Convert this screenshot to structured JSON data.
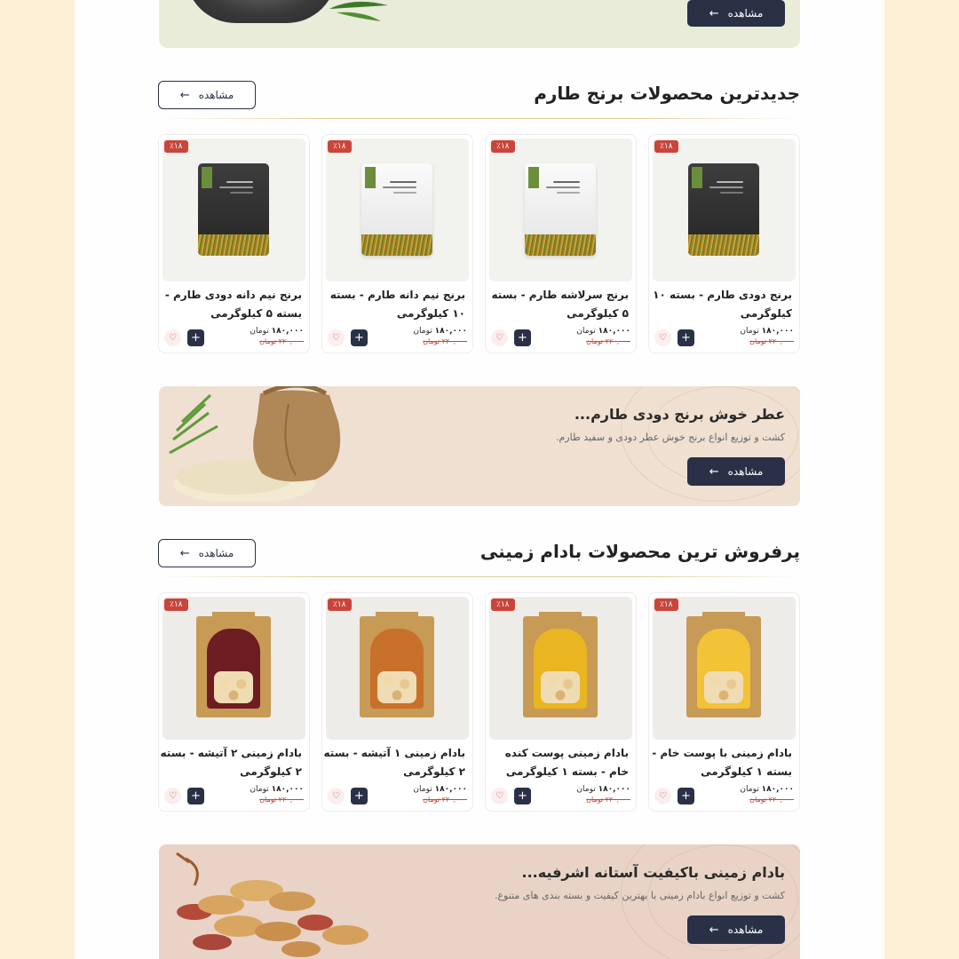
{
  "top_banner": {
    "view_label": "مشاهده"
  },
  "sections": [
    {
      "title": "جدیدترین محصولات برنج طارم",
      "view_label": "مشاهده",
      "products": [
        {
          "name": "برنج  دودی طارم - بسته ۱۰ کیلوگرمی",
          "badge": "٪۱۸",
          "price": "۱۸۰,۰۰۰",
          "currency": "تومان",
          "old_price": "۲۲۰,۰۰۰",
          "old_currency": "تومان",
          "image": "black-rice-bag"
        },
        {
          "name": "برنج سرلاشه طارم - بسته ۵ کیلوگرمی",
          "badge": "٪۱۸",
          "price": "۱۸۰,۰۰۰",
          "currency": "تومان",
          "old_price": "۲۲۰,۰۰۰",
          "old_currency": "تومان",
          "image": "white-rice-bag"
        },
        {
          "name": "برنج نیم دانه طارم - بسته ۱۰ کیلوگرمی",
          "badge": "٪۱۸",
          "price": "۱۸۰,۰۰۰",
          "currency": "تومان",
          "old_price": "۲۲۰,۰۰۰",
          "old_currency": "تومان",
          "image": "white-rice-bag"
        },
        {
          "name": "برنج نیم دانه دودی طارم - بسته ۵ کیلوگرمی",
          "badge": "٪۱۸",
          "price": "۱۸۰,۰۰۰",
          "currency": "تومان",
          "old_price": "۲۲۰,۰۰۰",
          "old_currency": "تومان",
          "image": "black-rice-bag"
        }
      ]
    },
    {
      "title": "پرفروش ترین محصولات بادام زمینی",
      "view_label": "مشاهده",
      "products": [
        {
          "name": "بادام زمینی با پوست خام - بسته ۱ کیلوگرمی",
          "badge": "٪۱۸",
          "price": "۱۸۰,۰۰۰",
          "currency": "تومان",
          "old_price": "۲۲۰,۰۰۰",
          "old_currency": "تومان",
          "image": "peanut-pack-yellow"
        },
        {
          "name": "بادام زمینی پوست کنده خام - بسته ۱ کیلوگرمی",
          "badge": "٪۱۸",
          "price": "۱۸۰,۰۰۰",
          "currency": "تومان",
          "old_price": "۲۲۰,۰۰۰",
          "old_currency": "تومان",
          "image": "peanut-pack-gold"
        },
        {
          "name": "بادام زمینی ۱ آتیشه - بسته ۲ کیلوگرمی",
          "badge": "٪۱۸",
          "price": "۱۸۰,۰۰۰",
          "currency": "تومان",
          "old_price": "۲۲۰,۰۰۰",
          "old_currency": "تومان",
          "image": "peanut-pack-orange"
        },
        {
          "name": "بادام زمینی ۲ آتیشه - بسته ۲ کیلوگرمی",
          "badge": "٪۱۸",
          "price": "۱۸۰,۰۰۰",
          "currency": "تومان",
          "old_price": "۲۲۰,۰۰۰",
          "old_currency": "تومان",
          "image": "peanut-pack-maroon"
        }
      ]
    }
  ],
  "rice_banner": {
    "title": "عطر خوش برنج دودی طارم...",
    "subtitle": "کشت و توزیع انواع برنج خوش عطر دودی و سفید طارم.",
    "view_label": "مشاهده"
  },
  "peanut_banner": {
    "title": "بادام زمینی باکیفیت آستانه اشرفیه...",
    "subtitle": "کشت و توزیع انواع بادام زمینی با بهترین کیفیت و بسته بندی های متنوع.",
    "view_label": "مشاهده"
  },
  "icons": {
    "arrow": "arrow-left-icon",
    "plus": "plus-icon",
    "heart": "heart-icon"
  },
  "colors": {
    "primary": "#2a3147",
    "discount": "#c9453b",
    "page_bg": "#fdf0d6"
  }
}
